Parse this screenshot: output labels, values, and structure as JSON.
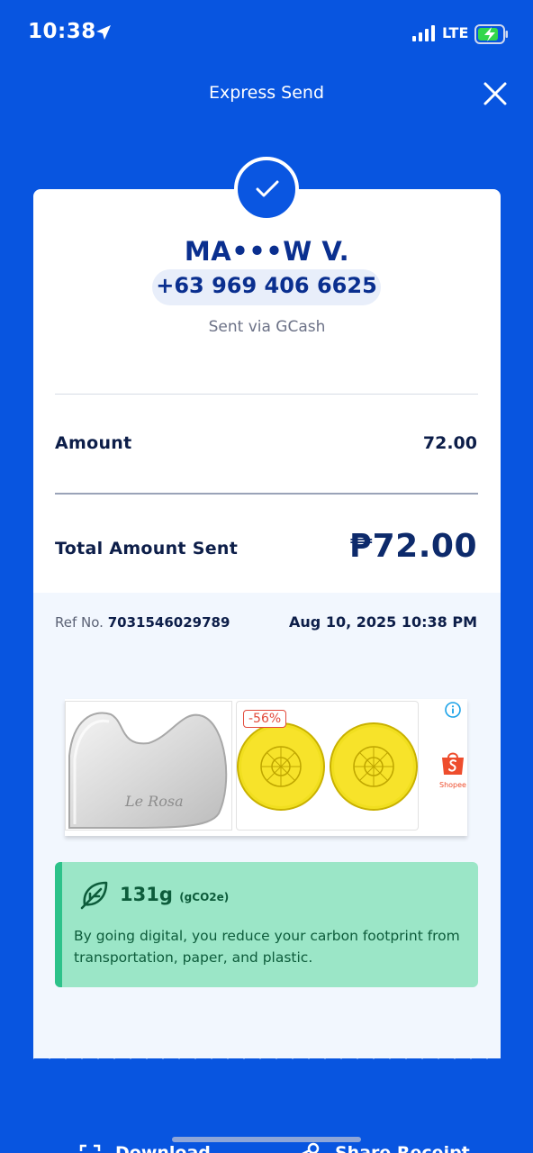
{
  "status_bar": {
    "time": "10:38",
    "network": "LTE",
    "battery_color": "#32d74b"
  },
  "header": {
    "title": "Express Send"
  },
  "recipient": {
    "name": "MA•••W V.",
    "phone": "+63 969 406 6625",
    "via": "Sent via GCash"
  },
  "amount": {
    "label": "Amount",
    "value": "72.00"
  },
  "total": {
    "label": "Total Amount Sent",
    "value": "₱72.00"
  },
  "reference": {
    "label": "Ref No.",
    "number": "7031546029789",
    "datetime": "Aug 10, 2025 10:38 PM"
  },
  "ad": {
    "discount": "-56%",
    "brand": "Shopee",
    "product_engraving": "Le Rosa"
  },
  "eco": {
    "amount": "131g",
    "unit": "(gCO2e)",
    "message": "By going digital, you reduce your carbon footprint from transportation, paper, and plastic."
  },
  "bottom_actions": {
    "download": "Download",
    "share": "Share Receipt"
  },
  "colors": {
    "primary": "#0855e0",
    "accent_green": "#2dc28a",
    "eco_bg": "#9be6c7",
    "sale_red": "#e24a3b"
  }
}
